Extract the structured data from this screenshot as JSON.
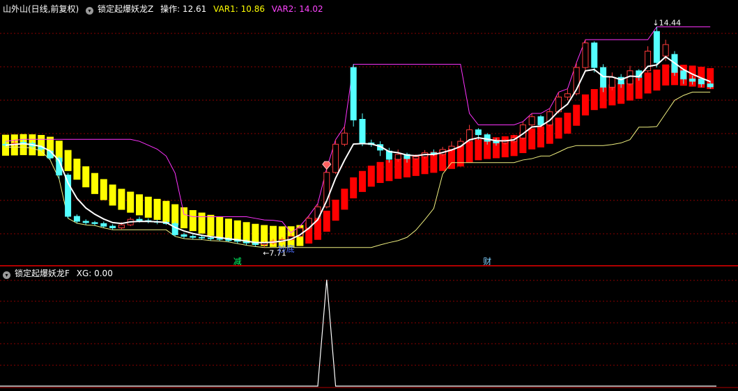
{
  "main_header": {
    "title": "山外山(日线,前复权)",
    "formula": "锁定起爆妖龙Z",
    "op_label": "操作: 12.61",
    "var1_label": "VAR1: 10.86",
    "var2_label": "VAR2: 14.02"
  },
  "sub_header": {
    "formula": "锁定起爆妖龙F",
    "xg_label": "XG: 0.00"
  },
  "colors": {
    "up": "#ff3b3b",
    "down": "#54ffff",
    "yellow_bar": "#ffff00",
    "red_bar": "#ff0000",
    "white_line": "#ffffff",
    "magenta_line": "#ff33ff",
    "yellow_line": "#f0f080",
    "grid": "#8b0000",
    "header_main": "#ffffff",
    "var1": "#ffff00",
    "var2": "#ff44ff"
  },
  "chart_data": [
    {
      "type": "candlestick",
      "title": "锁定起爆妖龙Z",
      "candles": [
        [
          10.86,
          10.83,
          10.95,
          10.77
        ],
        [
          10.86,
          10.89,
          10.98,
          10.8
        ],
        [
          10.92,
          10.91,
          11.01,
          10.84
        ],
        [
          10.89,
          10.8,
          10.95,
          10.74
        ],
        [
          10.77,
          10.71,
          10.83,
          10.65
        ],
        [
          10.65,
          10.44,
          10.71,
          10.38
        ],
        [
          10.44,
          9.92,
          10.5,
          9.8
        ],
        [
          9.92,
          8.66,
          9.98,
          8.6
        ],
        [
          8.66,
          8.51,
          8.72,
          8.45
        ],
        [
          8.51,
          8.47,
          8.57,
          8.4
        ],
        [
          8.47,
          8.44,
          8.52,
          8.38
        ],
        [
          8.44,
          8.36,
          8.5,
          8.31
        ],
        [
          8.36,
          8.31,
          8.42,
          8.25
        ],
        [
          8.31,
          8.4,
          8.48,
          8.27
        ],
        [
          8.4,
          8.57,
          8.63,
          8.36
        ],
        [
          8.57,
          8.53,
          8.65,
          8.47
        ],
        [
          8.53,
          8.5,
          8.6,
          8.45
        ],
        [
          8.5,
          8.48,
          8.55,
          8.42
        ],
        [
          8.48,
          8.44,
          8.54,
          8.4
        ],
        [
          8.44,
          8.1,
          8.5,
          8.05
        ],
        [
          8.1,
          8.05,
          8.16,
          7.98
        ],
        [
          8.05,
          8.02,
          8.11,
          7.96
        ],
        [
          8.02,
          8.0,
          8.08,
          7.95
        ],
        [
          8.0,
          7.98,
          8.05,
          7.92
        ],
        [
          7.98,
          7.97,
          8.03,
          7.91
        ],
        [
          7.97,
          7.92,
          8.02,
          7.88
        ],
        [
          7.92,
          7.9,
          7.98,
          7.83
        ],
        [
          7.9,
          7.85,
          7.96,
          7.78
        ],
        [
          7.85,
          7.8,
          7.9,
          7.74
        ],
        [
          7.8,
          7.85,
          7.91,
          7.71
        ],
        [
          7.85,
          7.9,
          7.97,
          7.79
        ],
        [
          7.9,
          7.95,
          8.02,
          7.86
        ],
        [
          7.95,
          8.05,
          8.13,
          7.92
        ],
        [
          8.05,
          8.3,
          8.36,
          8.02
        ],
        [
          8.3,
          8.6,
          8.68,
          8.24
        ],
        [
          8.6,
          8.95,
          9.05,
          8.56
        ],
        [
          8.95,
          10.0,
          10.12,
          8.9
        ],
        [
          10.0,
          10.86,
          11.0,
          9.95
        ],
        [
          10.86,
          11.2,
          11.4,
          10.8
        ],
        [
          13.2,
          11.6,
          13.3,
          11.4
        ],
        [
          11.62,
          10.9,
          11.8,
          10.8
        ],
        [
          10.9,
          10.85,
          11.0,
          10.78
        ],
        [
          10.85,
          10.68,
          10.95,
          10.5
        ],
        [
          10.65,
          10.4,
          10.75,
          10.3
        ],
        [
          10.4,
          10.55,
          10.7,
          10.32
        ],
        [
          10.55,
          10.42,
          10.6,
          10.3
        ],
        [
          10.42,
          10.48,
          10.55,
          10.38
        ],
        [
          10.48,
          10.6,
          10.68,
          10.42
        ],
        [
          10.6,
          10.55,
          10.7,
          10.5
        ],
        [
          10.55,
          10.7,
          10.78,
          10.5
        ],
        [
          10.7,
          10.8,
          10.95,
          10.62
        ],
        [
          10.8,
          10.95,
          11.05,
          10.75
        ],
        [
          10.95,
          11.3,
          11.45,
          10.9
        ],
        [
          11.3,
          11.15,
          11.35,
          11.0
        ],
        [
          11.15,
          10.95,
          11.2,
          10.85
        ],
        [
          10.95,
          10.9,
          11.05,
          10.82
        ],
        [
          10.9,
          10.95,
          11.02,
          10.85
        ],
        [
          10.95,
          11.05,
          11.15,
          10.9
        ],
        [
          11.05,
          11.45,
          11.55,
          11.0
        ],
        [
          11.45,
          11.7,
          11.8,
          11.38
        ],
        [
          11.7,
          11.45,
          11.75,
          11.38
        ],
        [
          11.45,
          11.85,
          11.95,
          11.4
        ],
        [
          11.85,
          12.3,
          12.45,
          11.8
        ],
        [
          12.3,
          12.4,
          12.55,
          12.2
        ],
        [
          12.4,
          13.2,
          13.35,
          12.35
        ],
        [
          13.2,
          13.95,
          14.05,
          13.1
        ],
        [
          13.95,
          13.2,
          14.0,
          13.05
        ],
        [
          13.2,
          12.6,
          13.3,
          12.45
        ],
        [
          12.6,
          12.9,
          13.05,
          12.5
        ],
        [
          12.9,
          12.7,
          13.0,
          12.58
        ],
        [
          12.7,
          13.1,
          13.25,
          12.65
        ],
        [
          13.1,
          12.9,
          13.15,
          12.8
        ],
        [
          13.1,
          13.7,
          13.85,
          13.05
        ],
        [
          14.3,
          13.35,
          14.44,
          13.2
        ],
        [
          13.55,
          13.9,
          14.05,
          13.4
        ],
        [
          13.6,
          13.05,
          13.7,
          12.95
        ],
        [
          13.1,
          12.85,
          13.15,
          12.7
        ],
        [
          12.85,
          12.78,
          12.95,
          12.68
        ],
        [
          12.85,
          12.7,
          12.9,
          12.6
        ],
        [
          12.7,
          12.61,
          12.8,
          12.55
        ]
      ],
      "low_label": "7.71",
      "high_label": "14.44",
      "signal_labels": [
        "减",
        "抄底",
        "财"
      ],
      "y_range": [
        7.45,
        14.75
      ],
      "grid": true
    },
    {
      "type": "line",
      "title": "锁定起爆妖龙F",
      "series": [
        {
          "name": "XG",
          "values": [
            0,
            0,
            0,
            0,
            0,
            0,
            0,
            0,
            0,
            0,
            0,
            0,
            0,
            0,
            0,
            0,
            0,
            0,
            0,
            0,
            0,
            0,
            0,
            0,
            0,
            0,
            0,
            0,
            0,
            0,
            0,
            0,
            0,
            0,
            0,
            0,
            1,
            0,
            0,
            0,
            0,
            0,
            0,
            0,
            0,
            0,
            0,
            0,
            0,
            0,
            0,
            0,
            0,
            0,
            0,
            0,
            0,
            0,
            0,
            0,
            0,
            0,
            0,
            0,
            0,
            0,
            0,
            0,
            0,
            0,
            0,
            0,
            0,
            0,
            0,
            0,
            0,
            0,
            0,
            0
          ]
        }
      ],
      "y_range": [
        0,
        1
      ],
      "grid": true
    }
  ]
}
